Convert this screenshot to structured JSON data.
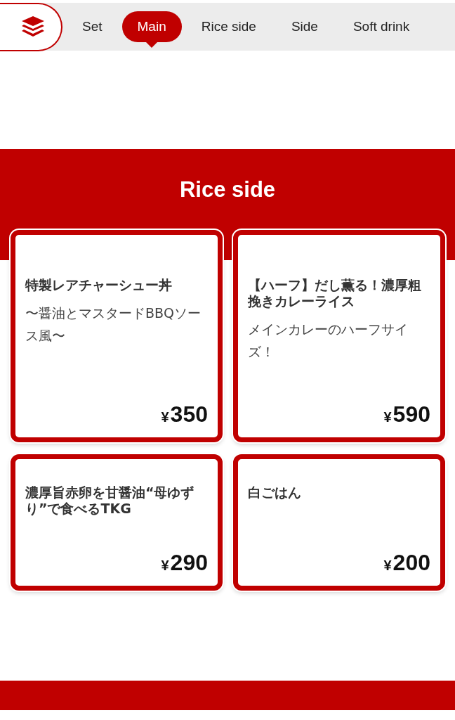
{
  "tabs": [
    {
      "label": "Set",
      "selected": false
    },
    {
      "label": "Main",
      "selected": true
    },
    {
      "label": "Rice side",
      "selected": false
    },
    {
      "label": "Side",
      "selected": false
    },
    {
      "label": "Soft drink",
      "selected": false
    }
  ],
  "section": {
    "title": "Rice side",
    "items": [
      {
        "name": "特製レアチャーシュー丼",
        "description": "〜醤油とマスタードBBQソース風〜",
        "currency": "¥",
        "price": "350"
      },
      {
        "name": "【ハーフ】だし薫る！濃厚粗挽きカレーライス",
        "description": "メインカレーのハーフサイズ！",
        "currency": "¥",
        "price": "590"
      },
      {
        "name": "濃厚旨赤卵を甘醤油“母ゆずり”で食べるTKG",
        "currency": "¥",
        "price": "290"
      },
      {
        "name": "白ごはん",
        "currency": "¥",
        "price": "200"
      }
    ]
  }
}
